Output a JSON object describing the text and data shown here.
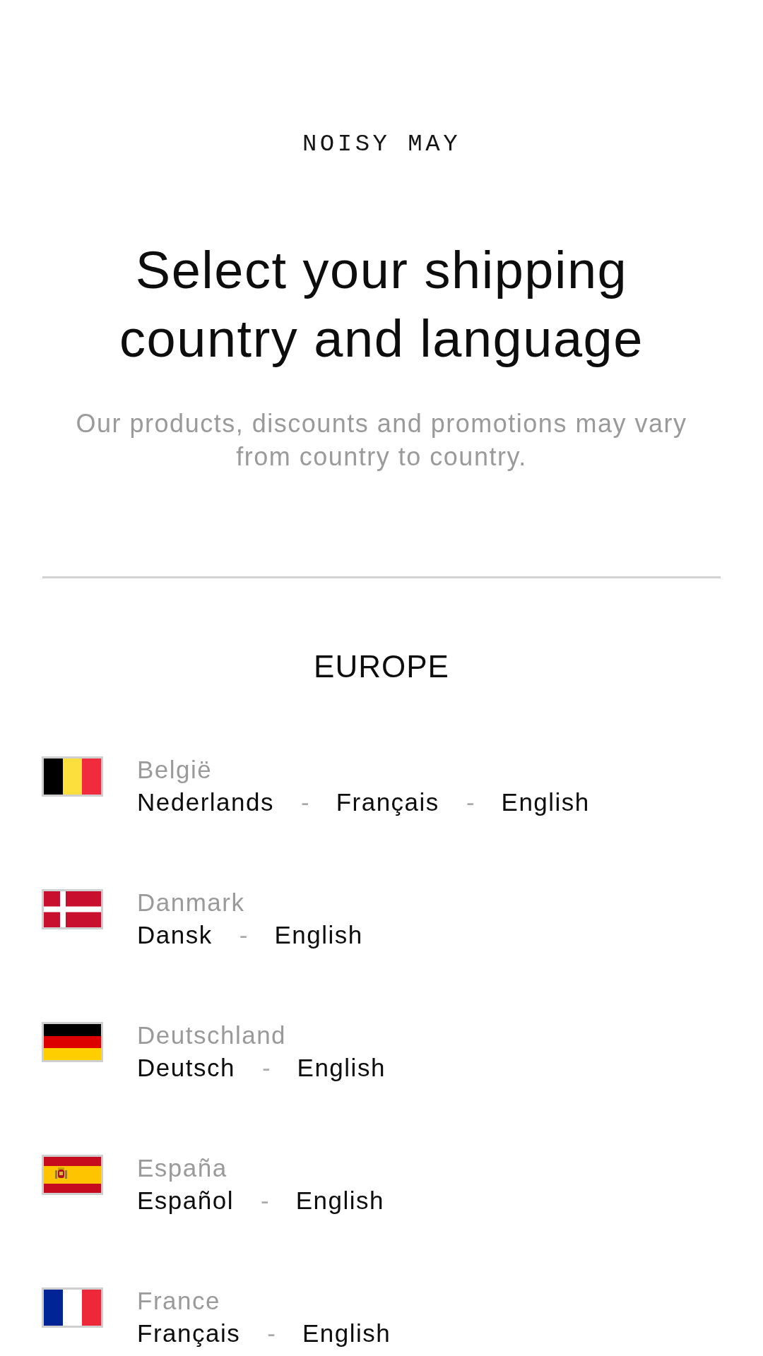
{
  "logo": "NOISY MAY",
  "heading": "Select your shipping country and language",
  "subtitle": "Our products, discounts and promotions may vary from country to country.",
  "region": "EUROPE",
  "countries": [
    {
      "kind": "belgium",
      "name": "België",
      "links": [
        {
          "kind": "language",
          "text": "Nederlands"
        },
        {
          "kind": "separator",
          "text": "-"
        },
        {
          "kind": "language",
          "text": "Français"
        },
        {
          "kind": "separator",
          "text": "-"
        },
        {
          "kind": "language",
          "text": "English"
        }
      ]
    },
    {
      "kind": "denmark",
      "name": "Danmark",
      "links": [
        {
          "kind": "language",
          "text": "Dansk"
        },
        {
          "kind": "separator",
          "text": "-"
        },
        {
          "kind": "language",
          "text": "English"
        }
      ]
    },
    {
      "kind": "germany",
      "name": "Deutschland",
      "links": [
        {
          "kind": "language",
          "text": "Deutsch"
        },
        {
          "kind": "separator",
          "text": "-"
        },
        {
          "kind": "language",
          "text": "English"
        }
      ]
    },
    {
      "kind": "spain",
      "name": "España",
      "links": [
        {
          "kind": "language",
          "text": "Español"
        },
        {
          "kind": "separator",
          "text": "-"
        },
        {
          "kind": "language",
          "text": "English"
        }
      ]
    },
    {
      "kind": "france",
      "name": "France",
      "links": [
        {
          "kind": "language",
          "text": "Français"
        },
        {
          "kind": "separator",
          "text": "-"
        },
        {
          "kind": "language",
          "text": "English"
        }
      ]
    }
  ]
}
